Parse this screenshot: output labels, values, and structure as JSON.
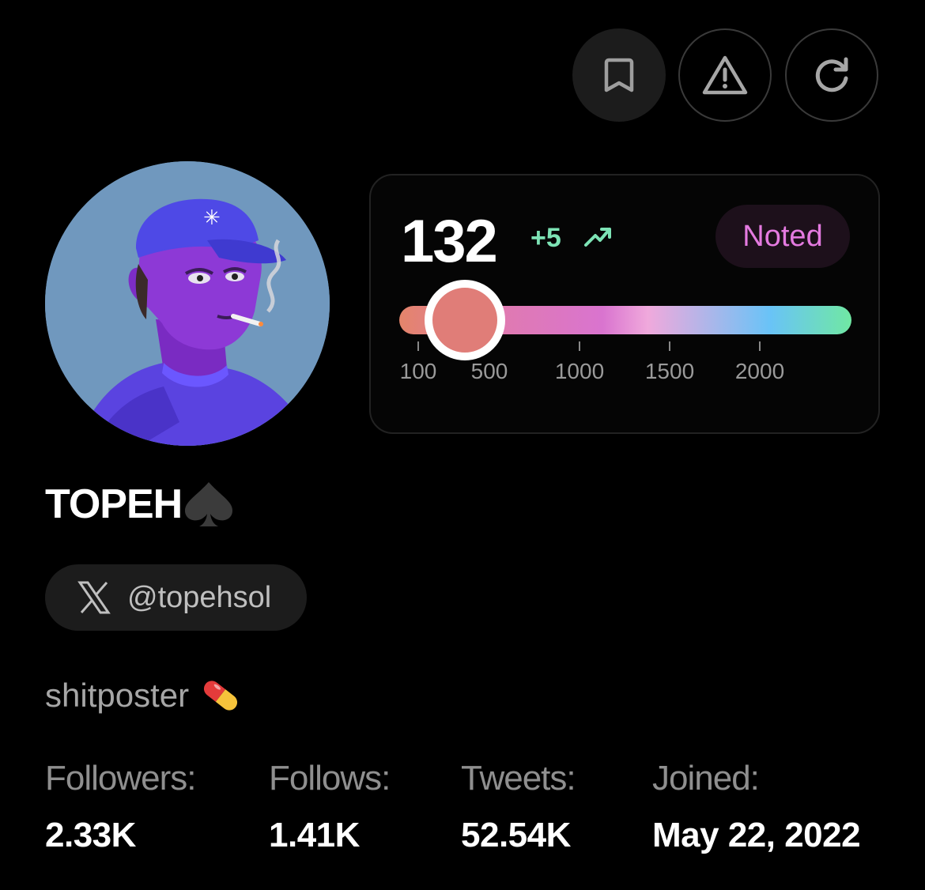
{
  "toolbar": {
    "bookmark_icon": "bookmark-icon",
    "report_icon": "warning-triangle-icon",
    "refresh_icon": "refresh-icon"
  },
  "profile": {
    "name": "TOPEH",
    "name_suffix_icon": "spade-icon",
    "handle": "@topehsol",
    "handle_icon": "x-logo-icon",
    "bio": "shitposter",
    "bio_icon": "pill-icon"
  },
  "score_card": {
    "score": "132",
    "delta": "+5",
    "trend_icon": "trending-up-icon",
    "badge": "Noted",
    "slider_value": 132,
    "ticks": [
      "100",
      "500",
      "1000",
      "1500",
      "2000"
    ],
    "colors": {
      "delta": "#7de3b5",
      "badge_text": "#e47ae0",
      "knob": "#e07d78"
    }
  },
  "stats": [
    {
      "label": "Followers:",
      "value": "2.33K"
    },
    {
      "label": "Follows:",
      "value": "1.41K"
    },
    {
      "label": "Tweets:",
      "value": "52.54K"
    },
    {
      "label": "Joined:",
      "value": "May 22, 2022"
    }
  ]
}
